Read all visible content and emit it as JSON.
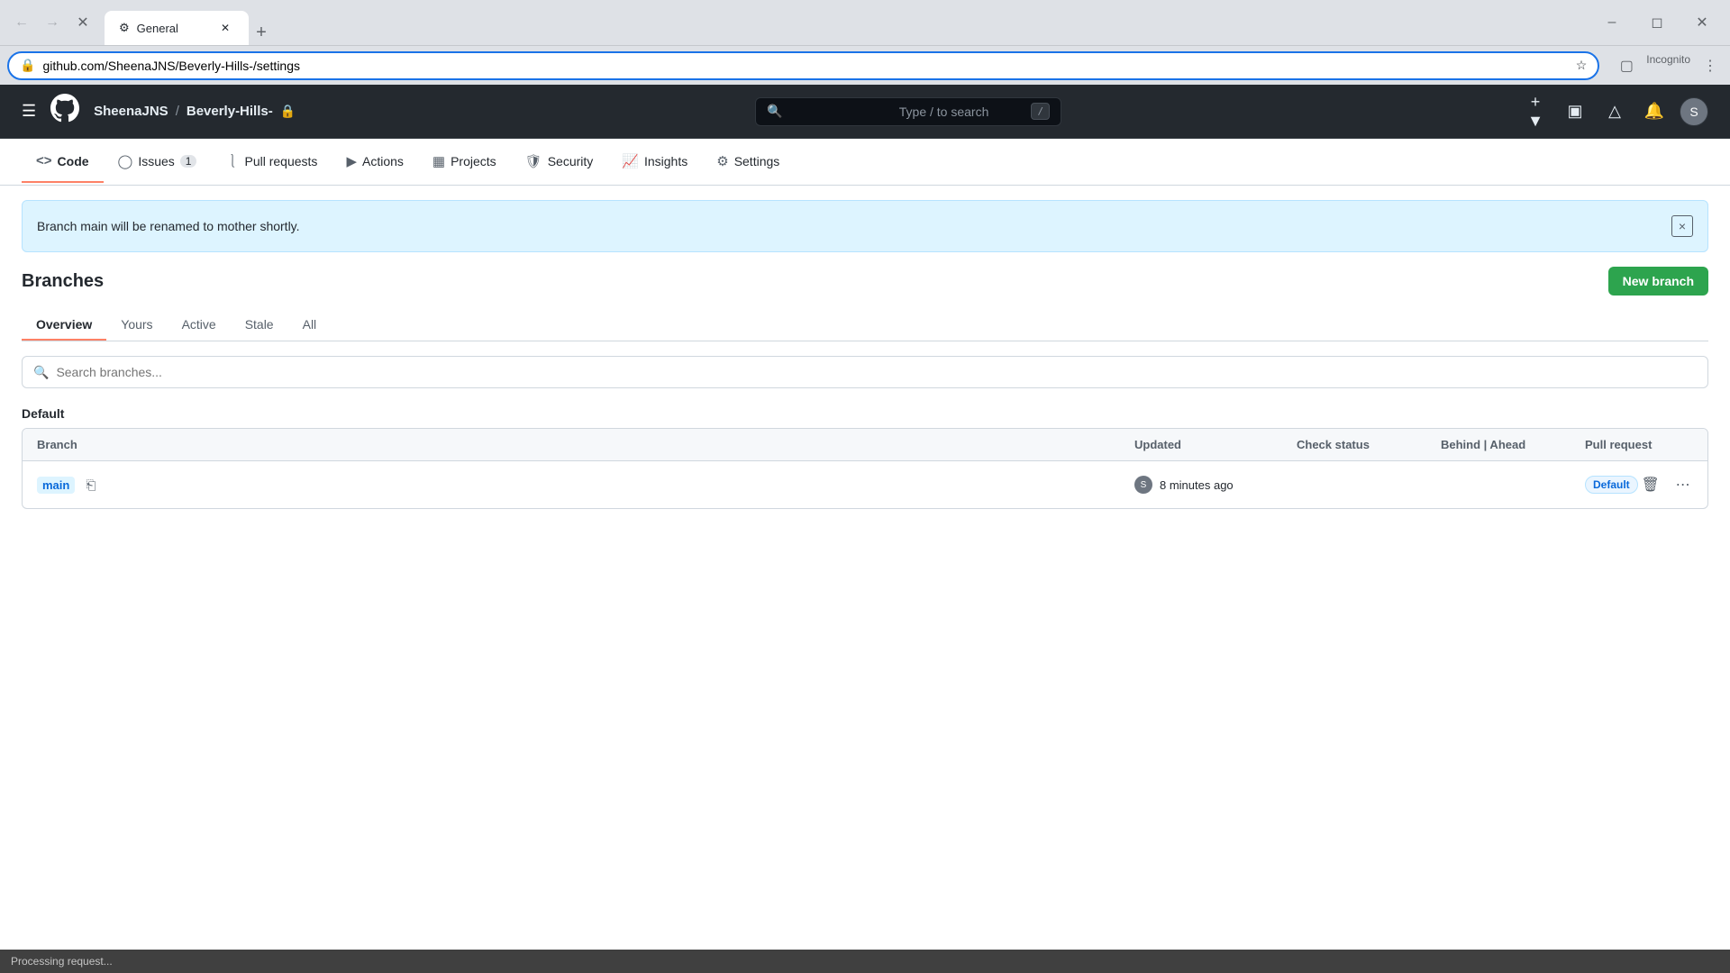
{
  "browser": {
    "tab": {
      "title": "General",
      "favicon": "⚙"
    },
    "address": "github.com/SheenaJNS/Beverly-Hills-/settings",
    "incognito_label": "Incognito"
  },
  "github": {
    "breadcrumb": {
      "user": "SheenaJNS",
      "separator": "/",
      "repo": "Beverly-Hills-",
      "lock_icon": "🔒"
    },
    "search": {
      "placeholder": "Type / to search",
      "shortcut": "/"
    },
    "nav": {
      "items": [
        {
          "label": "Code",
          "icon": "<>",
          "active": true
        },
        {
          "label": "Issues",
          "icon": "⊙",
          "badge": "1"
        },
        {
          "label": "Pull requests",
          "icon": "⎇"
        },
        {
          "label": "Actions",
          "icon": "▶"
        },
        {
          "label": "Projects",
          "icon": "▦"
        },
        {
          "label": "Security",
          "icon": "🛡"
        },
        {
          "label": "Insights",
          "icon": "📈"
        },
        {
          "label": "Settings",
          "icon": "⚙"
        }
      ]
    },
    "banner": {
      "text": "Branch main will be renamed to mother shortly.",
      "close_label": "×"
    },
    "branches": {
      "title": "Branches",
      "new_branch_label": "New branch",
      "tabs": [
        {
          "label": "Overview",
          "active": true
        },
        {
          "label": "Yours",
          "active": false
        },
        {
          "label": "Active",
          "active": false
        },
        {
          "label": "Stale",
          "active": false
        },
        {
          "label": "All",
          "active": false
        }
      ],
      "search_placeholder": "Search branches...",
      "section_label": "Default",
      "table": {
        "columns": [
          "Branch",
          "Updated",
          "Check status",
          "Behind  Ahead",
          "Pull request"
        ],
        "rows": [
          {
            "branch_name": "main",
            "updated": "8 minutes ago",
            "check_status": "",
            "behind_ahead": "",
            "pull_request": "Default"
          }
        ]
      }
    }
  },
  "status_bar": {
    "text": "Processing request..."
  }
}
